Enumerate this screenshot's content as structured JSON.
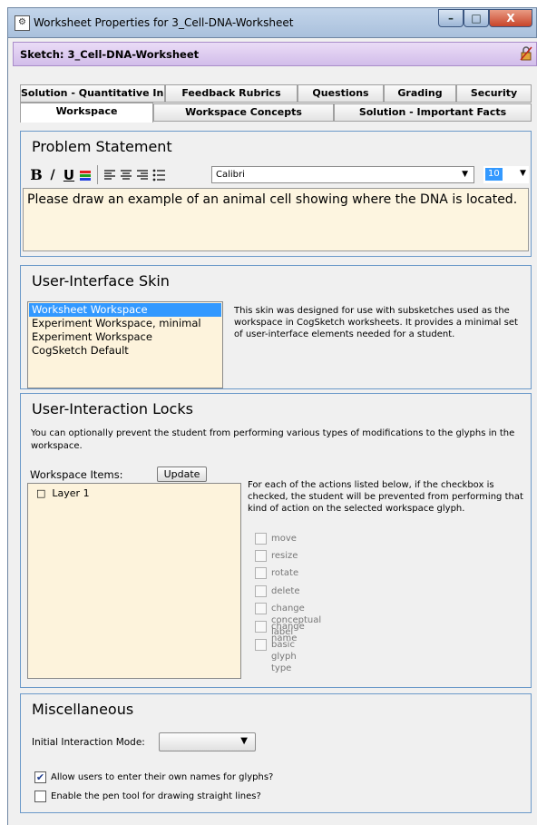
{
  "window": {
    "title": "Worksheet Properties for 3_Cell-DNA-Worksheet",
    "buttons": {
      "minimize": "–",
      "maximize": "□",
      "close": "X"
    }
  },
  "sketch_bar": {
    "label": "Sketch: 3_Cell-DNA-Worksheet"
  },
  "tabs": {
    "row1": [
      "Solution - Quantitative Ink",
      "Feedback Rubrics",
      "Questions",
      "Grading",
      "Security"
    ],
    "row2": [
      "Workspace",
      "Workspace Concepts",
      "Solution - Important Facts"
    ],
    "active": "Workspace"
  },
  "problem": {
    "title": "Problem Statement",
    "toolbar": {
      "bold": "B",
      "italic": "/",
      "underline": "U",
      "font": "Calibri",
      "size": "10"
    },
    "text": "Please draw an example of an animal cell showing where the DNA is located."
  },
  "skin": {
    "title": "User-Interface Skin",
    "items": [
      "Worksheet Workspace",
      "Experiment Workspace, minimal",
      "Experiment Workspace",
      "CogSketch Default"
    ],
    "selected": "Worksheet Workspace",
    "description": "This skin was designed for use with subsketches used as the workspace in CogSketch worksheets. It provides a minimal set of user-interface elements needed for a student."
  },
  "locks": {
    "title": "User-Interaction Locks",
    "description": "You can optionally prevent the student from performing various types of modifications to the glyphs in the workspace.",
    "workspace_items_label": "Workspace Items:",
    "update_label": "Update",
    "items": [
      "Layer 1"
    ],
    "checkbox_description": "For each of the actions listed below, if the checkbox is checked, the student will be prevented from performing that kind of action on the selected workspace glyph.",
    "actions": [
      "move",
      "resize",
      "rotate",
      "delete",
      "change conceptual label",
      "change name",
      "basic glyph type"
    ]
  },
  "misc": {
    "title": "Miscellaneous",
    "mode_label": "Initial Interaction Mode:",
    "mode_value": "",
    "options": [
      {
        "label": "Allow users to enter their own names for glyphs?",
        "checked": true
      },
      {
        "label": "Enable the pen tool for drawing straight lines?",
        "checked": false
      }
    ]
  },
  "colors": {
    "panel_border": "#6b99c9",
    "selection": "#3399ff",
    "text_area_bg": "#fdf5e0",
    "sketch_bar": "#d2bdea"
  }
}
